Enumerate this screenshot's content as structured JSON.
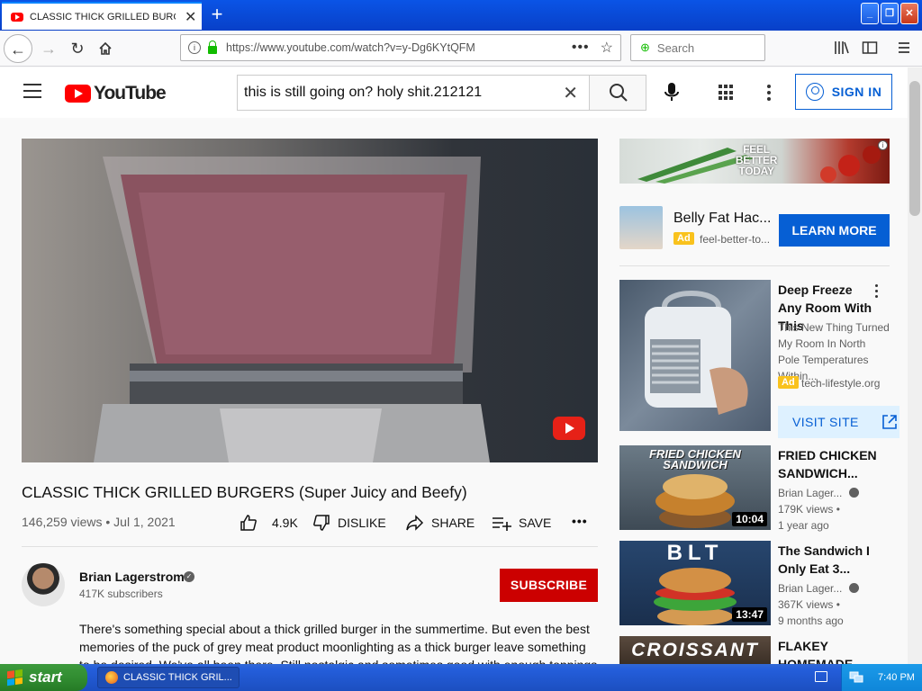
{
  "browser": {
    "tab_title": "CLASSIC THICK GRILLED BURGERS (Super Juicy and Beefy) - YouTube",
    "tab_close": "✕",
    "new_tab": "+",
    "url": "https://www.youtube.com/watch?v=y-Dg6KYtQFM",
    "url_more": "•••",
    "search_placeholder": "Search",
    "window_buttons": {
      "minimize": "_",
      "maximize": "❐",
      "close": "✕"
    }
  },
  "youtube": {
    "logo_text": "YouTube",
    "search_value": "this is still going on? holy shit.212121",
    "search_clear": "✕",
    "signin_label": "SIGN IN"
  },
  "video": {
    "title": "CLASSIC THICK GRILLED BURGERS (Super Juicy and Beefy)",
    "meta": "146,259 views • Jul 1, 2021",
    "likes": "4.9K",
    "dislike_label": "DISLIKE",
    "share_label": "SHARE",
    "save_label": "SAVE",
    "more": "•••",
    "channel": {
      "name": "Brian Lagerstrom",
      "verified": "✓",
      "subscribers": "417K subscribers",
      "subscribe_label": "SUBSCRIBE"
    },
    "description": "There's something special about a thick grilled burger in the summertime. But even the best memories of the puck of grey meat product moonlighting as a thick burger leave something to be desired. We've all been there. Still nostalgic and sometimes good with enough toppings"
  },
  "sidebar": {
    "banner": {
      "text": "FEEL BETTER TODAY",
      "info": "i"
    },
    "ad1": {
      "title": "Belly Fat Hac...",
      "badge": "Ad",
      "domain": "feel-better-to...",
      "cta": "LEARN MORE"
    },
    "ad2": {
      "title": "Deep Freeze Any Room With This",
      "description": "This New Thing Turned My Room In North Pole Temperatures Within...",
      "badge": "Ad",
      "domain": "tech-lifestyle.org",
      "cta": "VISIT SITE"
    },
    "videos": [
      {
        "thumb_text": "FRIED CHICKEN SANDWICH",
        "duration": "10:04",
        "title": "FRIED CHICKEN SANDWICH...",
        "channel": "Brian Lager...",
        "views": "179K views •",
        "age": "1 year ago"
      },
      {
        "thumb_text": "BLT",
        "duration": "13:47",
        "title": "The Sandwich I Only Eat 3...",
        "channel": "Brian Lager...",
        "views": "367K views •",
        "age": "9 months ago"
      },
      {
        "thumb_text": "CROISSANT",
        "duration": "",
        "title": "FLAKEY HOMEMADE",
        "channel": "",
        "views": "",
        "age": ""
      }
    ]
  },
  "taskbar": {
    "start_label": "start",
    "task_item": "CLASSIC THICK GRIL...",
    "clock": "7:40 PM"
  }
}
